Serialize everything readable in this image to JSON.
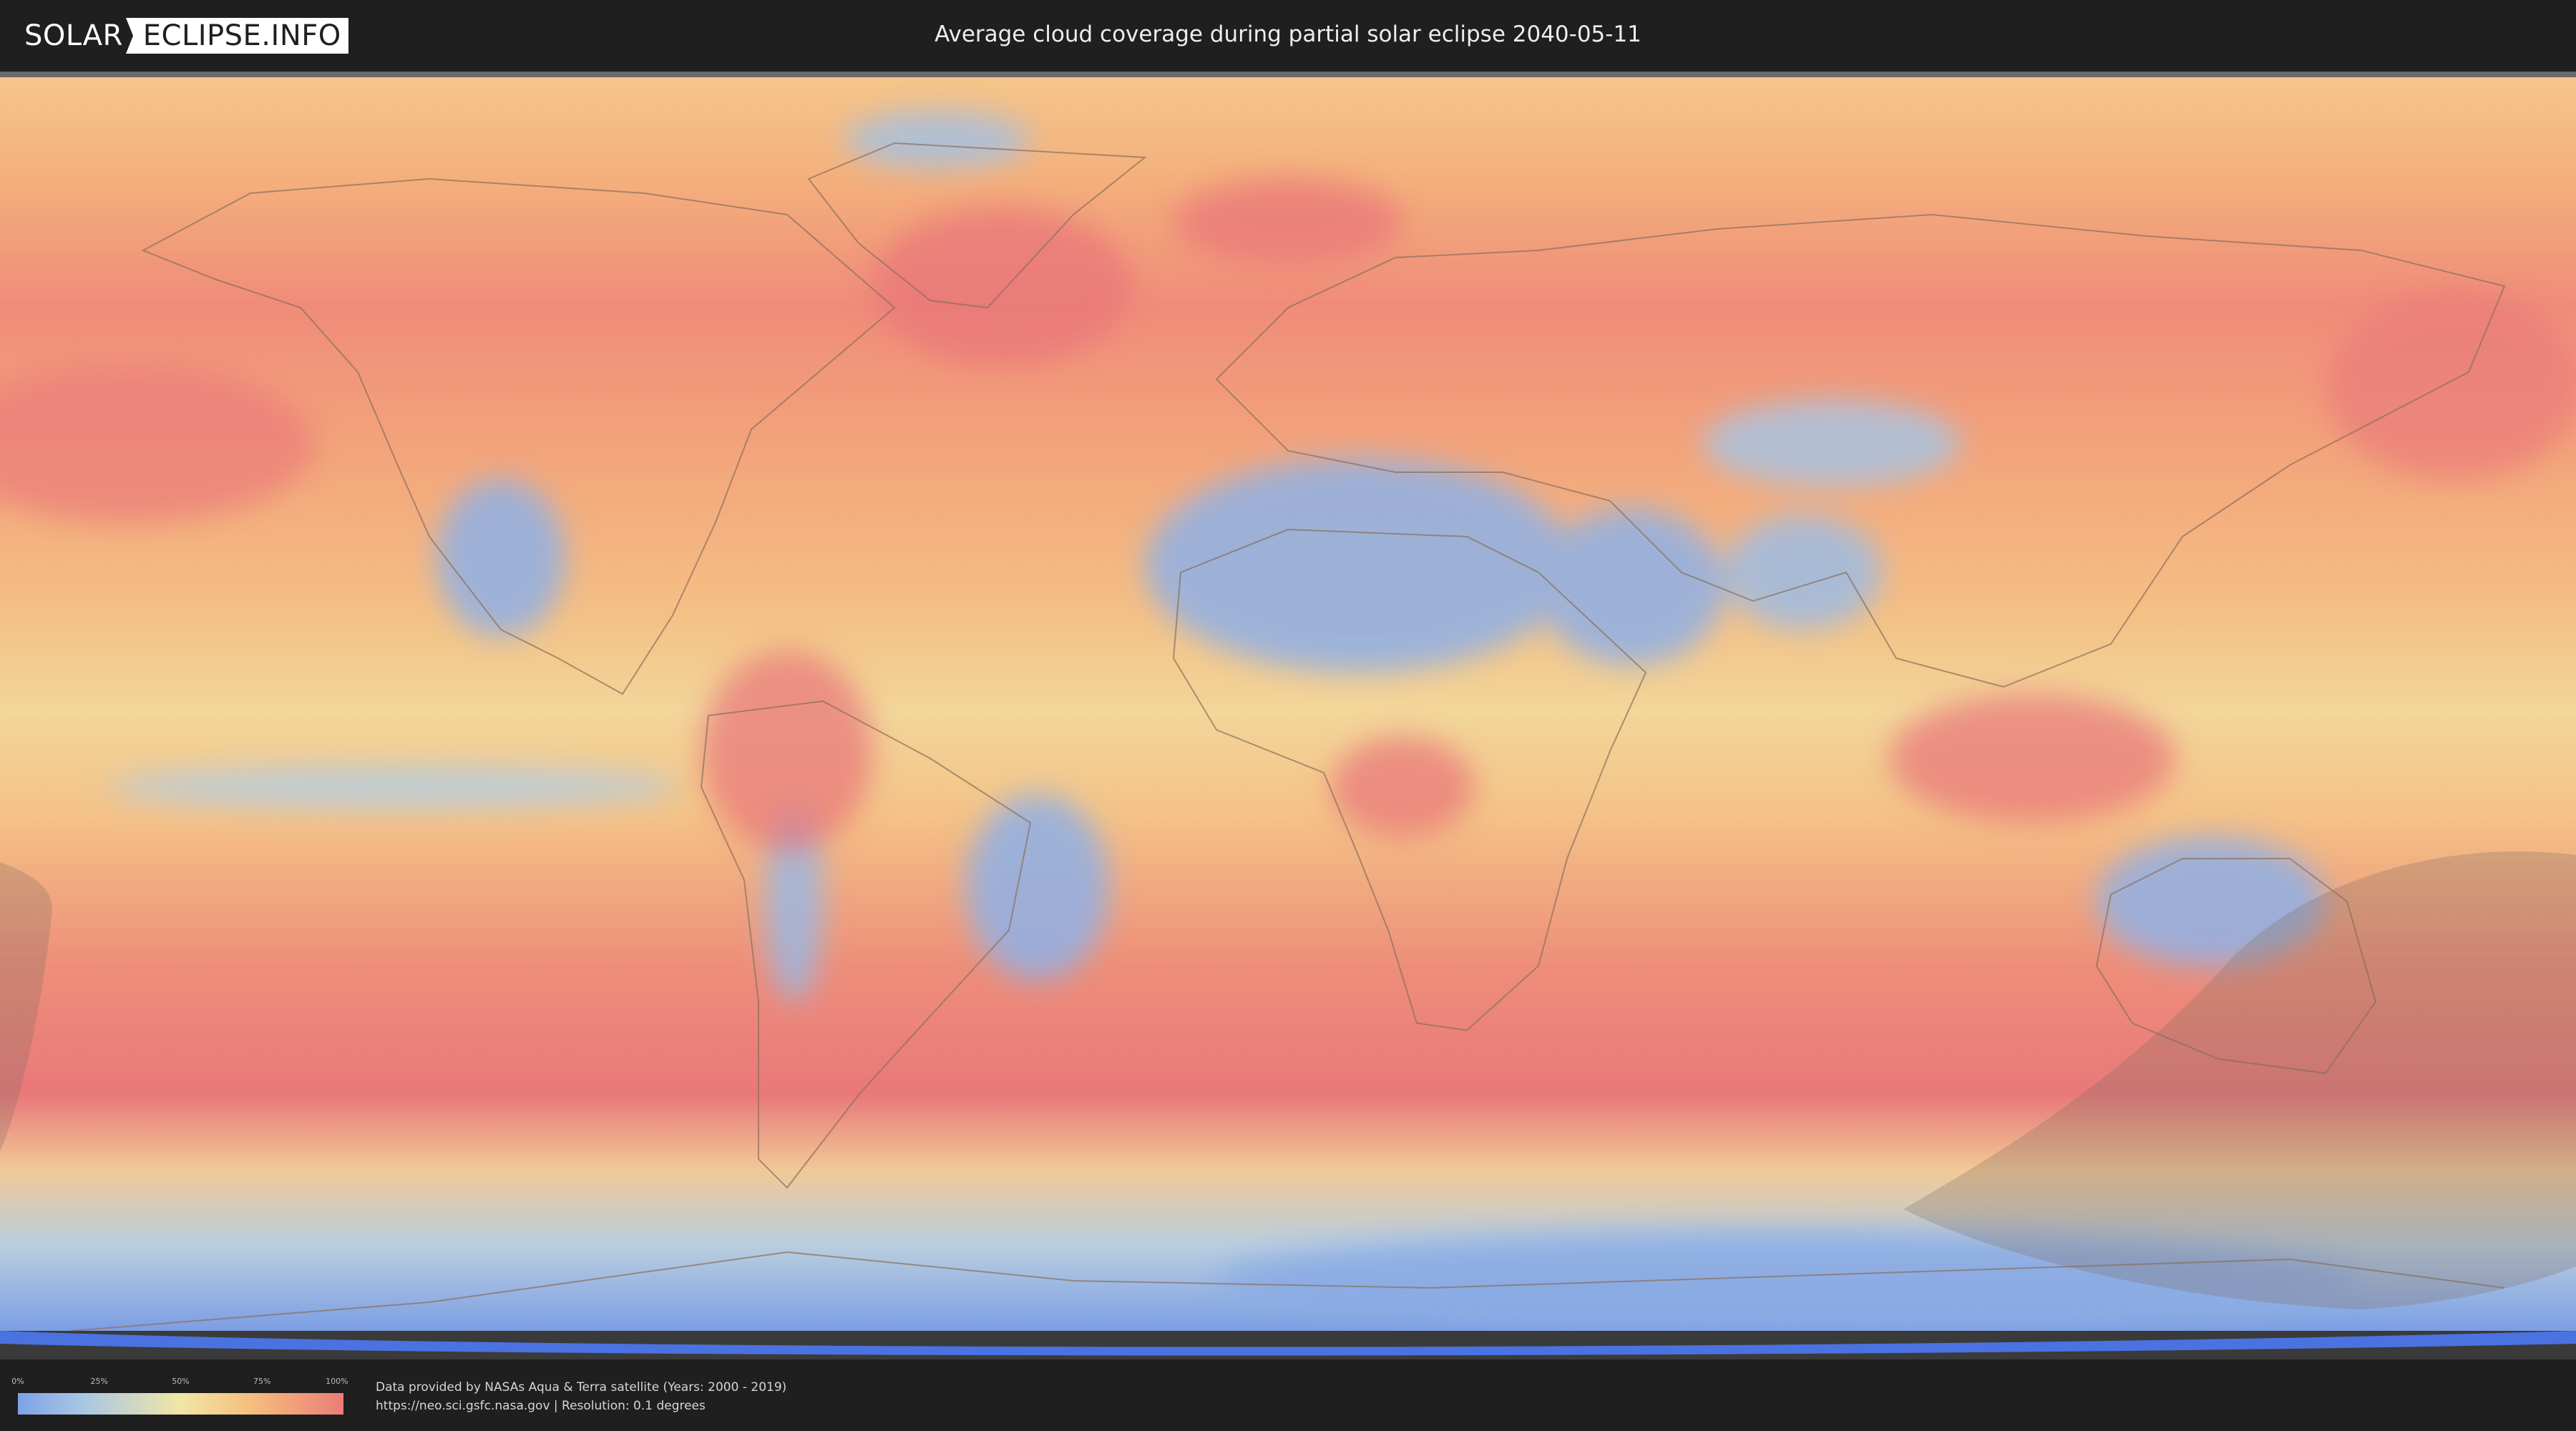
{
  "header": {
    "logo_left": "SOLAR",
    "logo_right": "ECLIPSE.INFO",
    "title": "Average cloud coverage during partial solar eclipse 2040-05-11"
  },
  "map": {
    "colors": {
      "clear": "#7da2e6",
      "low": "#a9c7e3",
      "mid": "#f1e6a6",
      "high": "#f5be7c",
      "overcast": "#ec7c78",
      "eclipse_shade": "#8a7a6a"
    }
  },
  "legend": {
    "ticks": [
      "0%",
      "25%",
      "50%",
      "75%",
      "100%"
    ],
    "tick_values": [
      0,
      0.25,
      0.5,
      0.75,
      1.0
    ]
  },
  "credits": {
    "line1": "Data provided by NASAs Aqua & Terra satellite (Years: 2000 - 2019)",
    "line2": "https://neo.sci.gsfc.nasa.gov | Resolution: 0.1 degrees"
  }
}
